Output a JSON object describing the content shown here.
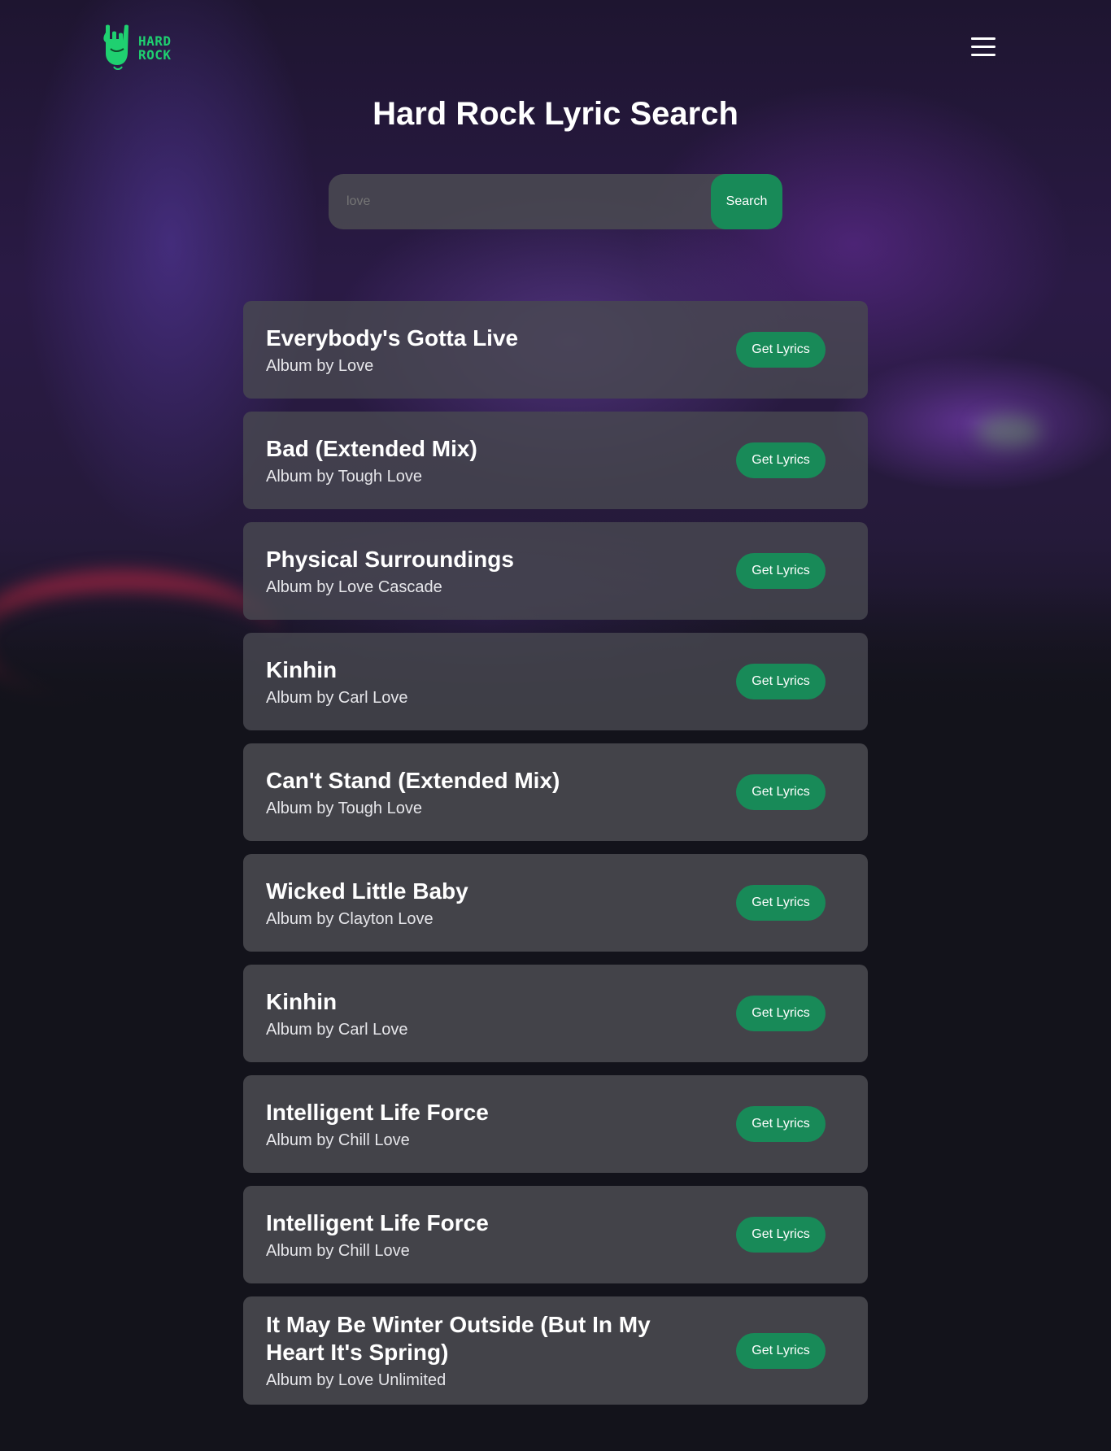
{
  "header": {
    "logo_line1": "HARD",
    "logo_line2": "ROCK"
  },
  "page_title": "Hard Rock Lyric Search",
  "search": {
    "value": "",
    "placeholder": "love",
    "button_label": "Search"
  },
  "results": [
    {
      "title": "Everybody's Gotta Live",
      "artist": "Album by Love",
      "button": "Get Lyrics"
    },
    {
      "title": "Bad (Extended Mix)",
      "artist": "Album by Tough Love",
      "button": "Get Lyrics"
    },
    {
      "title": "Physical Surroundings",
      "artist": "Album by Love Cascade",
      "button": "Get Lyrics"
    },
    {
      "title": "Kinhin",
      "artist": "Album by Carl Love",
      "button": "Get Lyrics"
    },
    {
      "title": "Can't Stand (Extended Mix)",
      "artist": "Album by Tough Love",
      "button": "Get Lyrics"
    },
    {
      "title": "Wicked Little Baby",
      "artist": "Album by Clayton Love",
      "button": "Get Lyrics"
    },
    {
      "title": "Kinhin",
      "artist": "Album by Carl Love",
      "button": "Get Lyrics"
    },
    {
      "title": "Intelligent Life Force",
      "artist": "Album by Chill Love",
      "button": "Get Lyrics"
    },
    {
      "title": "Intelligent Life Force",
      "artist": "Album by Chill Love",
      "button": "Get Lyrics"
    },
    {
      "title": "It May Be Winter Outside (But In My Heart It's Spring)",
      "artist": "Album by Love Unlimited",
      "button": "Get Lyrics"
    }
  ],
  "colors": {
    "accent": "#188a58",
    "logo": "#1fd070",
    "card": "#434349",
    "background": "#13131b"
  },
  "icons": {
    "logo": "rock-hand-icon",
    "menu": "hamburger-menu-icon"
  }
}
